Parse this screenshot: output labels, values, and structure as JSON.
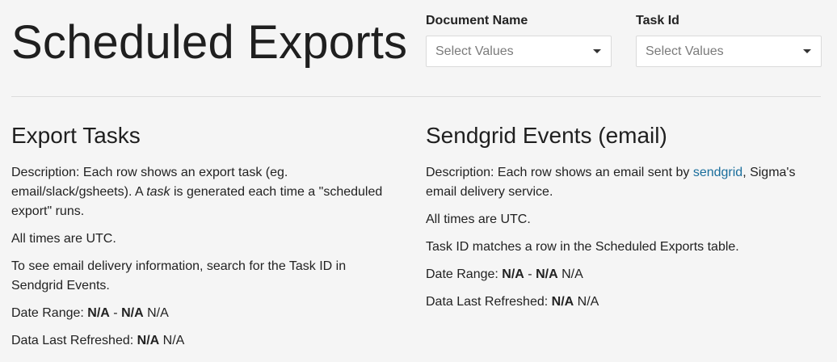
{
  "header": {
    "title": "Scheduled Exports"
  },
  "filters": {
    "document_name": {
      "label": "Document Name",
      "placeholder": "Select Values"
    },
    "task_id": {
      "label": "Task Id",
      "placeholder": "Select Values"
    }
  },
  "export_tasks": {
    "title": "Export Tasks",
    "desc_prefix": "Description: Each row shows an export task (eg. email/slack/gsheets). A ",
    "desc_em": "task",
    "desc_suffix": " is generated each time a \"scheduled export\" runs.",
    "times": "All times are UTC.",
    "search_hint": "To see email delivery information, search for the Task ID in Sendgrid Events.",
    "date_range_label": "Date Range: ",
    "date_range_start": "N/A",
    "date_range_sep": " - ",
    "date_range_end": "N/A",
    "date_range_extra": " N/A",
    "refreshed_label": "Data Last Refreshed: ",
    "refreshed_value": "N/A",
    "refreshed_extra": " N/A"
  },
  "sendgrid_events": {
    "title": "Sendgrid Events (email)",
    "desc_prefix": "Description: Each row shows an email sent by ",
    "desc_link": "sendgrid",
    "desc_suffix": ", Sigma's email delivery service.",
    "times": "All times are UTC.",
    "task_match": "Task ID matches a row in the Scheduled Exports table.",
    "date_range_label": "Date Range: ",
    "date_range_start": "N/A",
    "date_range_sep": " - ",
    "date_range_end": "N/A",
    "date_range_extra": " N/A",
    "refreshed_label": "Data Last Refreshed: ",
    "refreshed_value": "N/A",
    "refreshed_extra": " N/A"
  }
}
